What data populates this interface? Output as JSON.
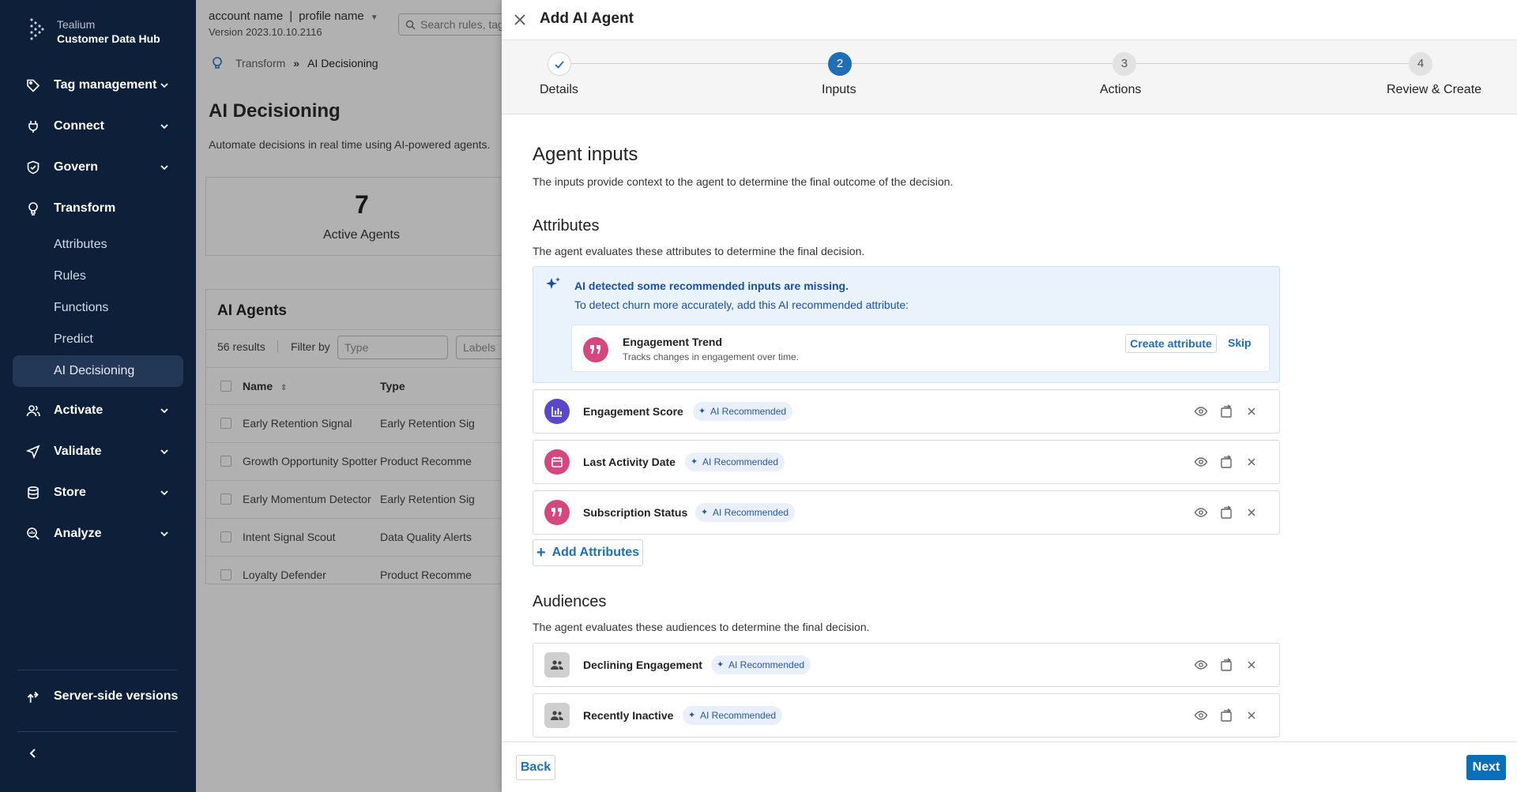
{
  "sidebar": {
    "brand_line1": "Tealium",
    "brand_line2": "Customer Data Hub",
    "nav": [
      {
        "label": "Tag management"
      },
      {
        "label": "Connect"
      },
      {
        "label": "Govern"
      },
      {
        "label": "Transform"
      },
      {
        "label": "Activate"
      },
      {
        "label": "Validate"
      },
      {
        "label": "Store"
      },
      {
        "label": "Analyze"
      }
    ],
    "transform_sub": [
      "Attributes",
      "Rules",
      "Functions",
      "Predict",
      "AI Decisioning"
    ],
    "active_sub": "AI Decisioning",
    "server_side": "Server-side versions"
  },
  "header": {
    "account": "account name",
    "separator": "|",
    "profile": "profile name",
    "version": "Version 2023.10.10.2116",
    "search_placeholder": "Search rules, tag"
  },
  "breadcrumb": {
    "parent": "Transform",
    "current": "AI Decisioning"
  },
  "page": {
    "title": "AI Decisioning",
    "subtitle": "Automate decisions in real time using AI-powered agents.",
    "stat_value": "7",
    "stat_label": "Active Agents"
  },
  "agents": {
    "title": "AI Agents",
    "results": "56 results",
    "filter_by": "Filter by",
    "type_placeholder": "Type",
    "labels_placeholder": "Labels",
    "col_name": "Name",
    "col_type": "Type",
    "rows": [
      {
        "name": "Early Retention Signal",
        "type": "Early Retention Sig"
      },
      {
        "name": "Growth Opportunity Spotter",
        "type": "Product  Recomme"
      },
      {
        "name": "Early Momentum Detector",
        "type": "Early Retention Sig"
      },
      {
        "name": "Intent Signal Scout",
        "type": "Data Quality Alerts"
      },
      {
        "name": "Loyalty Defender",
        "type": "Product  Recomme"
      }
    ]
  },
  "drawer": {
    "title": "Add AI Agent",
    "steps": [
      {
        "num": "1",
        "label": "Details",
        "state": "done"
      },
      {
        "num": "2",
        "label": "Inputs",
        "state": "current"
      },
      {
        "num": "3",
        "label": "Actions",
        "state": "todo"
      },
      {
        "num": "4",
        "label": "Review & Create",
        "state": "todo"
      }
    ],
    "section_title": "Agent inputs",
    "section_desc": "The inputs provide context to the agent to determine the final outcome of the decision.",
    "attributes": {
      "title": "Attributes",
      "desc": "The agent evaluates these attributes to determine the final decision.",
      "ai_notice_title": "AI detected some recommended inputs are missing.",
      "ai_notice_text": "To detect churn more accurately, add this AI recommended attribute:",
      "recommendation": {
        "name": "Engagement Trend",
        "desc": "Tracks changes in engagement over time.",
        "create_label": "Create attribute",
        "skip_label": "Skip"
      },
      "items": [
        {
          "name": "Engagement Score",
          "badge": "AI Recommended",
          "icon": "bar-chart-icon"
        },
        {
          "name": "Last Activity Date",
          "badge": "AI Recommended",
          "icon": "calendar-icon"
        },
        {
          "name": "Subscription Status",
          "badge": "AI Recommended",
          "icon": "quote-icon"
        }
      ],
      "add_label": "Add Attributes"
    },
    "audiences": {
      "title": "Audiences",
      "desc": "The agent evaluates these audiences to determine the final decision.",
      "items": [
        {
          "name": "Declining Engagement",
          "badge": "AI Recommended",
          "icon": "people-icon"
        },
        {
          "name": "Recently Inactive",
          "badge": "AI Recommended",
          "icon": "people-icon"
        }
      ]
    },
    "back_label": "Back",
    "next_label": "Next"
  },
  "colors": {
    "sidebar_bg": "#0e1f3a",
    "primary": "#1d6fb8",
    "badge_bg": "#e9f0fb",
    "avatar_purple": "#5b47c9",
    "avatar_pink": "#d5477e"
  }
}
